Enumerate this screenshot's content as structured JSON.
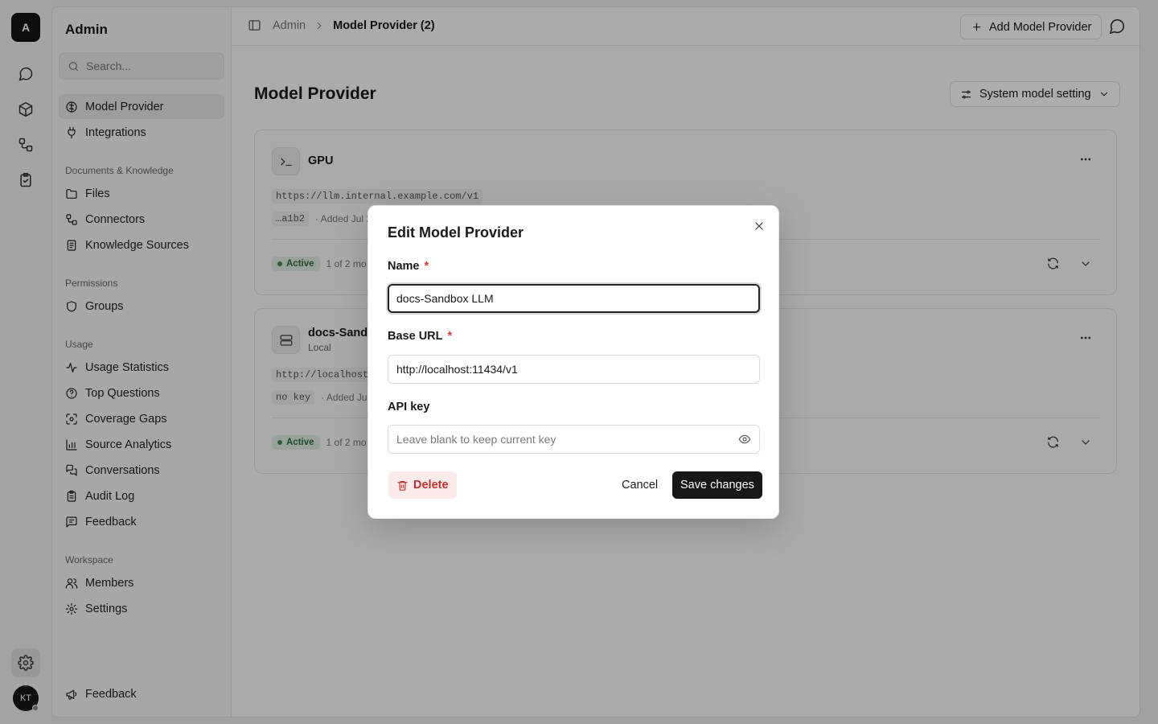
{
  "rail": {
    "logo_letter": "A",
    "avatar_initials": "KT",
    "icons": [
      "chat-icon",
      "cube-icon",
      "workflow-icon",
      "clipboard-check-icon",
      "gear-icon"
    ]
  },
  "sidebar": {
    "title": "Admin",
    "search_placeholder": "Search...",
    "top_items": [
      {
        "label": "Model Provider",
        "icon": "brain-icon",
        "active": true
      },
      {
        "label": "Integrations",
        "icon": "plug-icon"
      }
    ],
    "sections": [
      {
        "title": "Documents & Knowledge",
        "items": [
          {
            "label": "Files",
            "icon": "folder-icon"
          },
          {
            "label": "Connectors",
            "icon": "connector-icon"
          },
          {
            "label": "Knowledge Sources",
            "icon": "book-icon"
          }
        ]
      },
      {
        "title": "Permissions",
        "items": [
          {
            "label": "Groups",
            "icon": "shield-icon"
          }
        ]
      },
      {
        "title": "Usage",
        "items": [
          {
            "label": "Usage Statistics",
            "icon": "activity-icon"
          },
          {
            "label": "Top Questions",
            "icon": "help-circle-icon"
          },
          {
            "label": "Coverage Gaps",
            "icon": "scan-icon"
          },
          {
            "label": "Source Analytics",
            "icon": "bar-chart-icon"
          },
          {
            "label": "Conversations",
            "icon": "messages-icon"
          },
          {
            "label": "Audit Log",
            "icon": "clipboard-icon"
          },
          {
            "label": "Feedback",
            "icon": "message-square-icon"
          }
        ]
      },
      {
        "title": "Workspace",
        "items": [
          {
            "label": "Members",
            "icon": "users-icon"
          },
          {
            "label": "Settings",
            "icon": "gear-icon"
          }
        ]
      }
    ],
    "footer_item": {
      "label": "Feedback",
      "icon": "megaphone-icon"
    }
  },
  "topbar": {
    "breadcrumb_root": "Admin",
    "breadcrumb_current": "Model Provider (2)",
    "add_button": "Add Model Provider"
  },
  "main": {
    "title": "Model Provider",
    "system_button": "System model setting",
    "providers": [
      {
        "name": "GPU",
        "sub": "",
        "url": "https://llm.internal.example.com/v1",
        "key_chip": "…a1b2",
        "added": "· Added Jul 2",
        "status": "Active",
        "models": "1 of 2 mo"
      },
      {
        "name": "docs-Sandb",
        "sub": "Local",
        "url": "http://localhost:",
        "key_chip": "no key",
        "added": "· Added Jul",
        "status": "Active",
        "models": "1 of 2 mo"
      }
    ]
  },
  "dialog": {
    "title": "Edit Model Provider",
    "name_label": "Name",
    "name_value": "docs-Sandbox LLM",
    "url_label": "Base URL",
    "url_value": "http://localhost:11434/v1",
    "key_label": "API key",
    "key_placeholder": "Leave blank to keep current key",
    "required_mark": "*",
    "delete_label": "Delete",
    "cancel_label": "Cancel",
    "save_label": "Save changes"
  },
  "colors": {
    "accent": "#171717",
    "danger": "#c43030",
    "active_badge": "#2d6a3a"
  }
}
